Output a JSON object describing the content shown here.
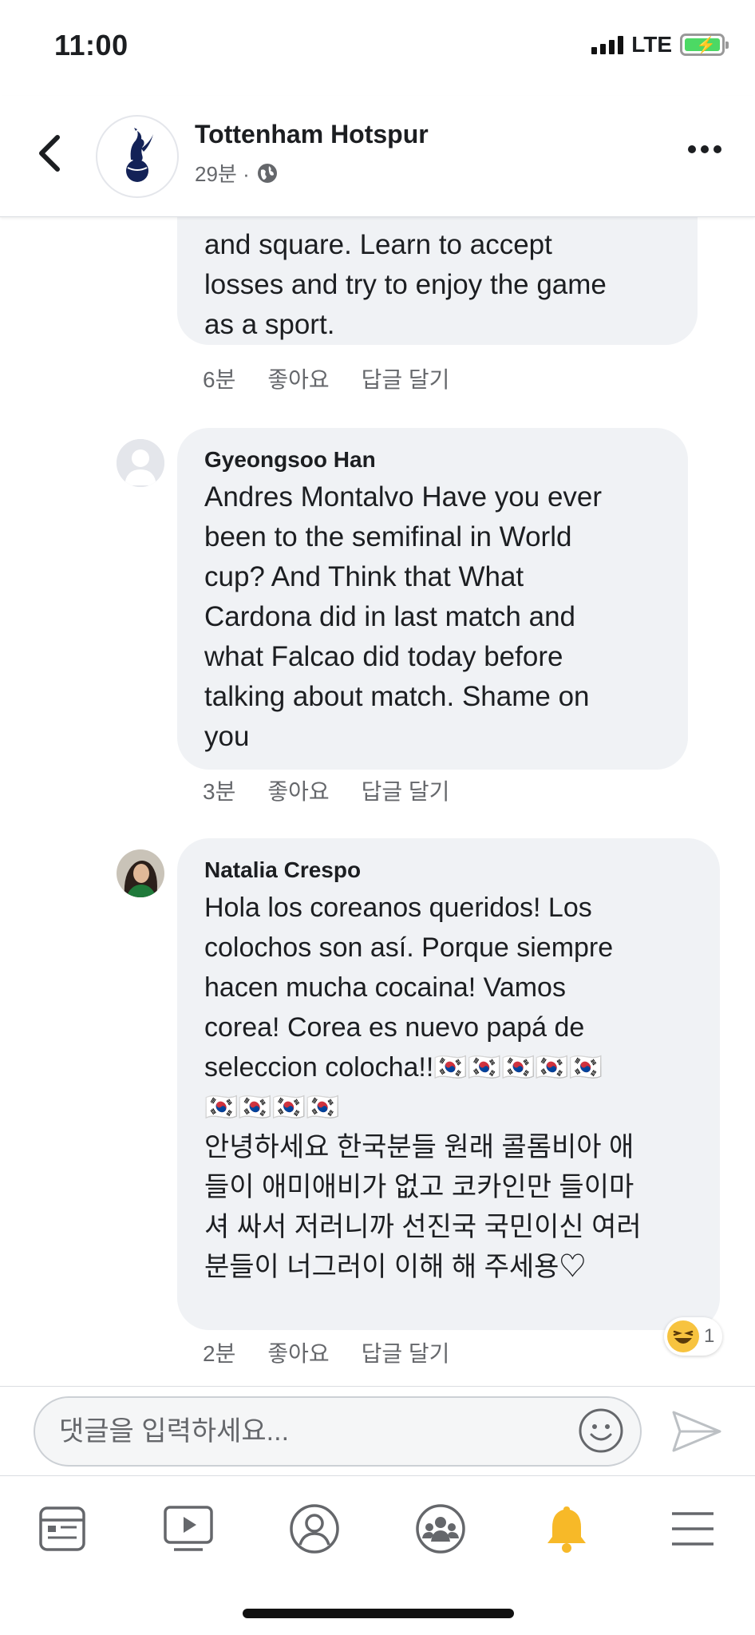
{
  "status_bar": {
    "time": "11:00",
    "network": "LTE"
  },
  "header": {
    "page_name": "Tottenham Hotspur",
    "post_time": "29분 ·",
    "icons": [
      "back-icon",
      "spurs-logo",
      "globe-icon",
      "more-icon"
    ]
  },
  "comments": [
    {
      "author": "",
      "text": "and square. Learn to accept\nlosses and try to enjoy the game\nas a sport.",
      "time": "6분",
      "like_label": "좋아요",
      "reply_label": "답글 달기"
    },
    {
      "author": "Gyeongsoo Han",
      "text": "Andres Montalvo Have you ever\nbeen to the semifinal in World\ncup? And Think that What\nCardona did in last match and\nwhat Falcao did today before\ntalking about match. Shame on\nyou",
      "time": "3분",
      "like_label": "좋아요",
      "reply_label": "답글 달기"
    },
    {
      "author": "Natalia Crespo",
      "text": "Hola los coreanos queridos! Los\ncolochos son así. Porque siempre\nhacen mucha cocaina! Vamos\ncorea! Corea es nuevo papá de\nseleccion colocha!!🇰🇷🇰🇷🇰🇷🇰🇷🇰🇷\n🇰🇷🇰🇷🇰🇷🇰🇷\n안녕하세요 한국분들 원래 콜롬비아 애\n들이 애미애비가 없고 코카인만 들이마\n셔 싸서 저러니까 선진국 국민이신 여러\n분들이 너그러이 이해 해 주세용♡",
      "time": "2분",
      "like_label": "좋아요",
      "reply_label": "답글 달기",
      "reaction": {
        "icon": "haha-icon",
        "count": "1"
      }
    }
  ],
  "composer": {
    "placeholder": "댓글을 입력하세요..."
  },
  "bottom_nav": [
    "news-feed-icon",
    "watch-icon",
    "profile-icon",
    "groups-icon",
    "notifications-icon",
    "menu-icon"
  ],
  "colors": {
    "bubble": "#f0f2f5",
    "meta_text": "#65676b",
    "bell_active": "#f7b928",
    "spurs_navy": "#132257"
  }
}
